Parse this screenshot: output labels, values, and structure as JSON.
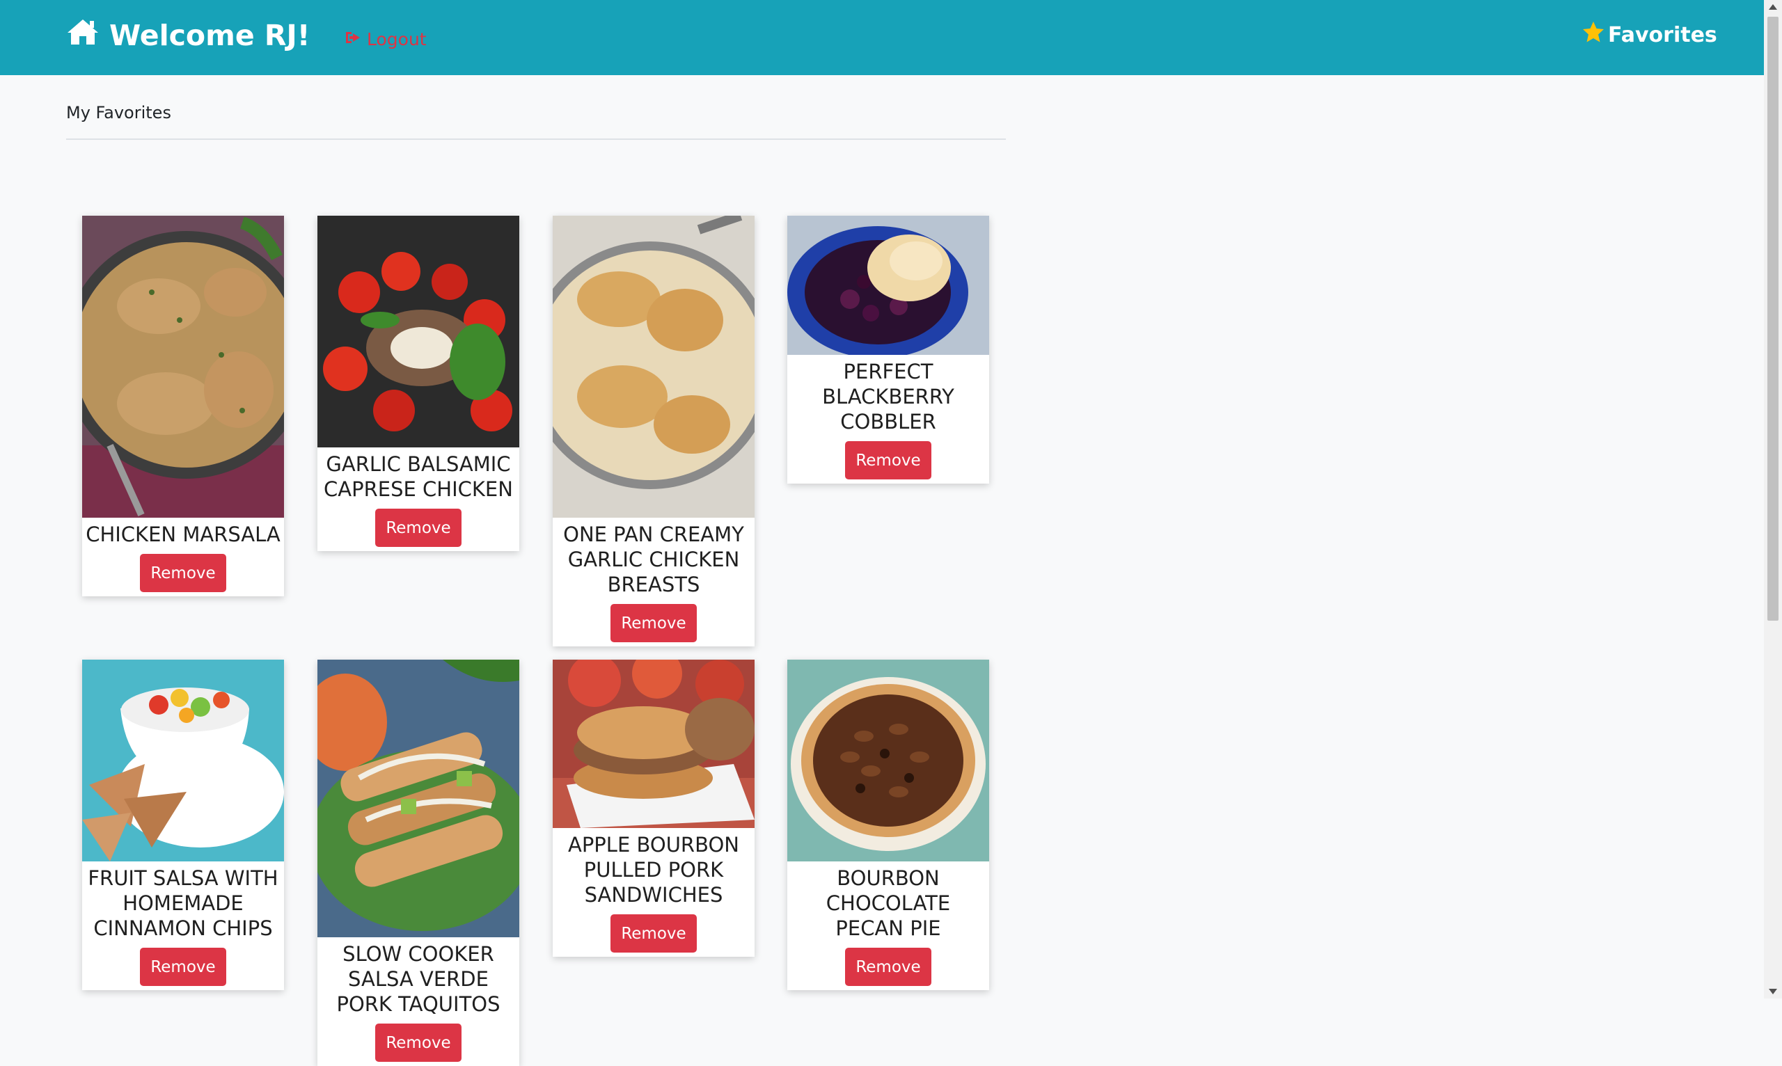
{
  "navbar": {
    "brand_text": "Welcome RJ!",
    "brand_icon": "home-icon",
    "logout_label": "Logout",
    "logout_icon": "sign-out-icon",
    "favorites_label": "Favorites",
    "favorites_icon": "star-icon"
  },
  "section": {
    "title": "My Favorites"
  },
  "cards": [
    {
      "title": "CHICKEN MARSALA",
      "button": "Remove"
    },
    {
      "title": "GARLIC BALSAMIC CAPRESE CHICKEN",
      "button": "Remove"
    },
    {
      "title": "ONE PAN CREAMY GARLIC CHICKEN BREASTS",
      "button": "Remove"
    },
    {
      "title": "PERFECT BLACKBERRY COBBLER",
      "button": "Remove"
    },
    {
      "title": "FRUIT SALSA WITH HOMEMADE CINNAMON CHIPS",
      "button": "Remove"
    },
    {
      "title": "SLOW COOKER SALSA VERDE PORK TAQUITOS",
      "button": "Remove"
    },
    {
      "title": "APPLE BOURBON PULLED PORK SANDWICHES",
      "button": "Remove"
    },
    {
      "title": "BOURBON CHOCOLATE PECAN PIE",
      "button": "Remove"
    }
  ],
  "colors": {
    "navbar": "#17a2b8",
    "danger": "#dc3545",
    "star": "#ffc107",
    "background": "#f8f9fa"
  }
}
